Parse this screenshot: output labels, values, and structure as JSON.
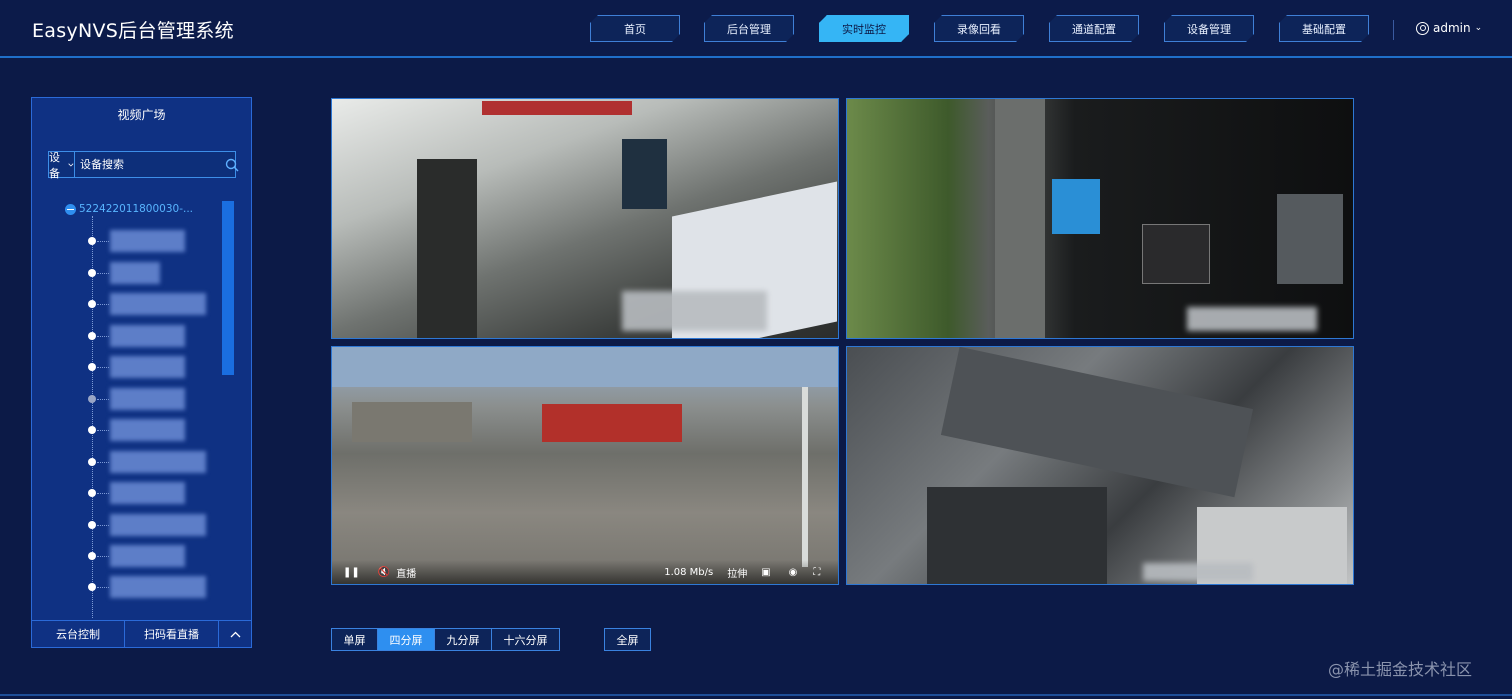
{
  "app": {
    "title": "EasyNVS后台管理系统"
  },
  "nav": {
    "items": [
      {
        "label": "首页"
      },
      {
        "label": "后台管理"
      },
      {
        "label": "实时监控",
        "active": true
      },
      {
        "label": "录像回看"
      },
      {
        "label": "通道配置"
      },
      {
        "label": "设备管理"
      },
      {
        "label": "基础配置"
      }
    ],
    "user": "admin"
  },
  "sidebar": {
    "title": "视频广场",
    "search": {
      "select": "设备",
      "placeholder": "设备搜索"
    },
    "tree": {
      "root": "522422011800030-..."
    },
    "footer": {
      "ptz": "云台控制",
      "qr": "扫码看直播"
    }
  },
  "player": {
    "bitrate": "1.08 Mb/s",
    "live": "直播",
    "stretch": "拉伸"
  },
  "layouts": {
    "single": "单屏",
    "four": "四分屏",
    "nine": "九分屏",
    "sixteen": "十六分屏",
    "fullscreen": "全屏"
  },
  "watermark": "@稀土掘金技术社区",
  "colors": {
    "accent": "#35b5f5",
    "background": "#0c1a47",
    "panel": "#0f3183"
  }
}
